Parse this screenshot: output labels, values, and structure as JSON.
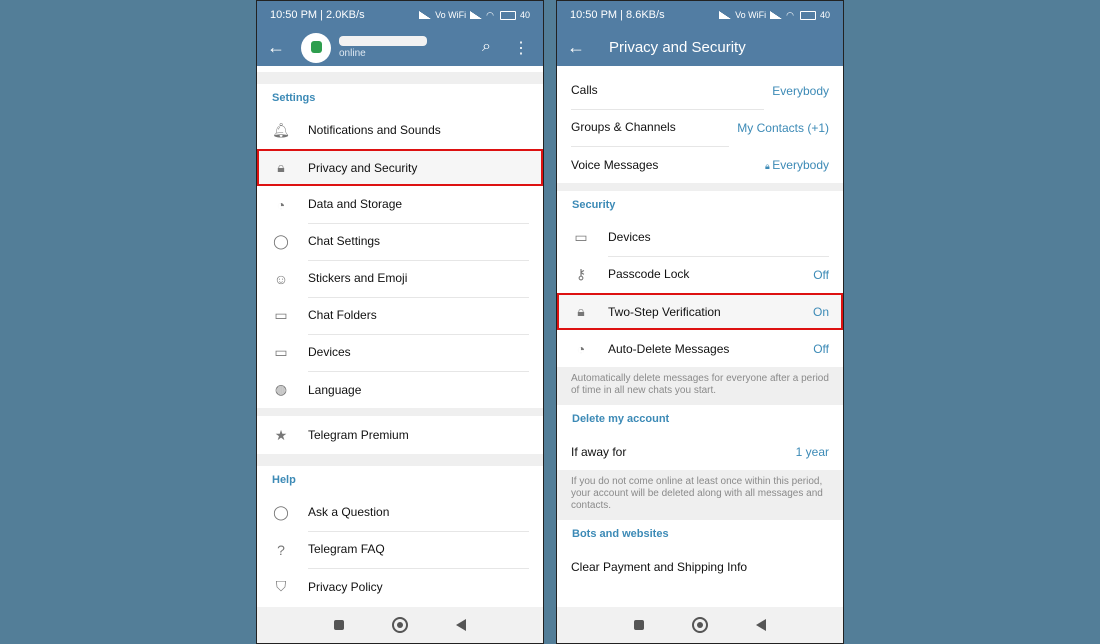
{
  "left": {
    "status": {
      "time": "10:50 PM | 2.0KB/s",
      "net": "Vo WiFi",
      "battery": "40"
    },
    "topbar": {
      "back": "←",
      "name": "",
      "subtitle": "online"
    },
    "settings_header": "Settings",
    "items": [
      {
        "label": "Notifications and Sounds",
        "icon": "bell-icon"
      },
      {
        "label": "Privacy and Security",
        "icon": "lock-icon"
      },
      {
        "label": "Data and Storage",
        "icon": "pie-chart-icon"
      },
      {
        "label": "Chat Settings",
        "icon": "chat-bubble-icon"
      },
      {
        "label": "Stickers and Emoji",
        "icon": "sticker-icon"
      },
      {
        "label": "Chat Folders",
        "icon": "folder-icon"
      },
      {
        "label": "Devices",
        "icon": "devices-icon"
      },
      {
        "label": "Language",
        "icon": "globe-icon"
      }
    ],
    "premium": "Telegram Premium",
    "help_header": "Help",
    "help_items": [
      {
        "label": "Ask a Question",
        "icon": "question-bubble-icon"
      },
      {
        "label": "Telegram FAQ",
        "icon": "faq-icon"
      },
      {
        "label": "Privacy Policy",
        "icon": "shield-icon"
      }
    ]
  },
  "right": {
    "status": {
      "time": "10:50 PM | 8.6KB/s",
      "net": "Vo WiFi",
      "battery": "40"
    },
    "title": "Privacy and Security",
    "privacy_rows": [
      {
        "label": "Calls",
        "value": "Everybody"
      },
      {
        "label": "Groups & Channels",
        "value": "My Contacts (+1)"
      },
      {
        "label": "Voice Messages",
        "value": "Everybody"
      }
    ],
    "security_header": "Security",
    "security_rows": [
      {
        "label": "Devices",
        "value": "",
        "icon": "devices-icon"
      },
      {
        "label": "Passcode Lock",
        "value": "Off",
        "icon": "key-icon"
      },
      {
        "label": "Two-Step Verification",
        "value": "On",
        "icon": "lock-icon"
      },
      {
        "label": "Auto-Delete Messages",
        "value": "Off",
        "icon": "timer-icon"
      }
    ],
    "auto_delete_note": "Automatically delete messages for everyone after a period of time in all new chats you start.",
    "delete_header": "Delete my account",
    "if_away": {
      "label": "If away for",
      "value": "1 year"
    },
    "delete_note": "If you do not come online at least once within this period, your account will be deleted along with all messages and contacts.",
    "bots_header": "Bots and websites",
    "clear_payment": "Clear Payment and Shipping Info"
  },
  "colors": {
    "header": "#527da3",
    "accent": "#3c8ab6",
    "highlight": "#d11111",
    "background": "#537e98"
  }
}
